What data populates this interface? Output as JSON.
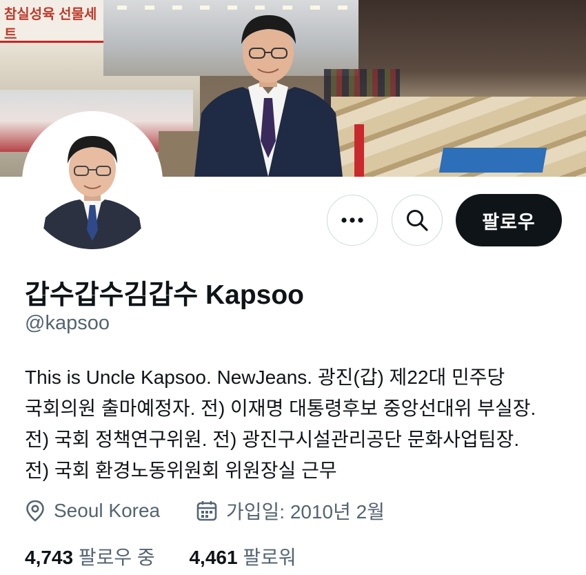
{
  "banner": {
    "sign_text": "참실성육 선물세트"
  },
  "actions": {
    "more_icon": "more-horizontal-icon",
    "search_icon": "search-icon",
    "follow_label": "팔로우"
  },
  "profile": {
    "display_name": "갑수갑수김갑수 Kapsoo",
    "handle": "@kapsoo",
    "bio_lines": [
      "This is Uncle Kapsoo. NewJeans. 광진(갑) 제22대 민주당",
      "국회의원 출마예정자. 전) 이재명 대통령후보 중앙선대위 부실장.",
      "전) 국회 정책연구위원. 전) 광진구시설관리공단 문화사업팀장.",
      "전) 국회 환경노동위원회 위원장실 근무"
    ],
    "location": "Seoul Korea",
    "location_icon": "map-pin-icon",
    "joined": "가입일: 2010년 2월",
    "joined_icon": "calendar-icon"
  },
  "stats": {
    "following_count": "4,743",
    "following_label": "팔로우 중",
    "followers_count": "4,461",
    "followers_label": "팔로워"
  }
}
